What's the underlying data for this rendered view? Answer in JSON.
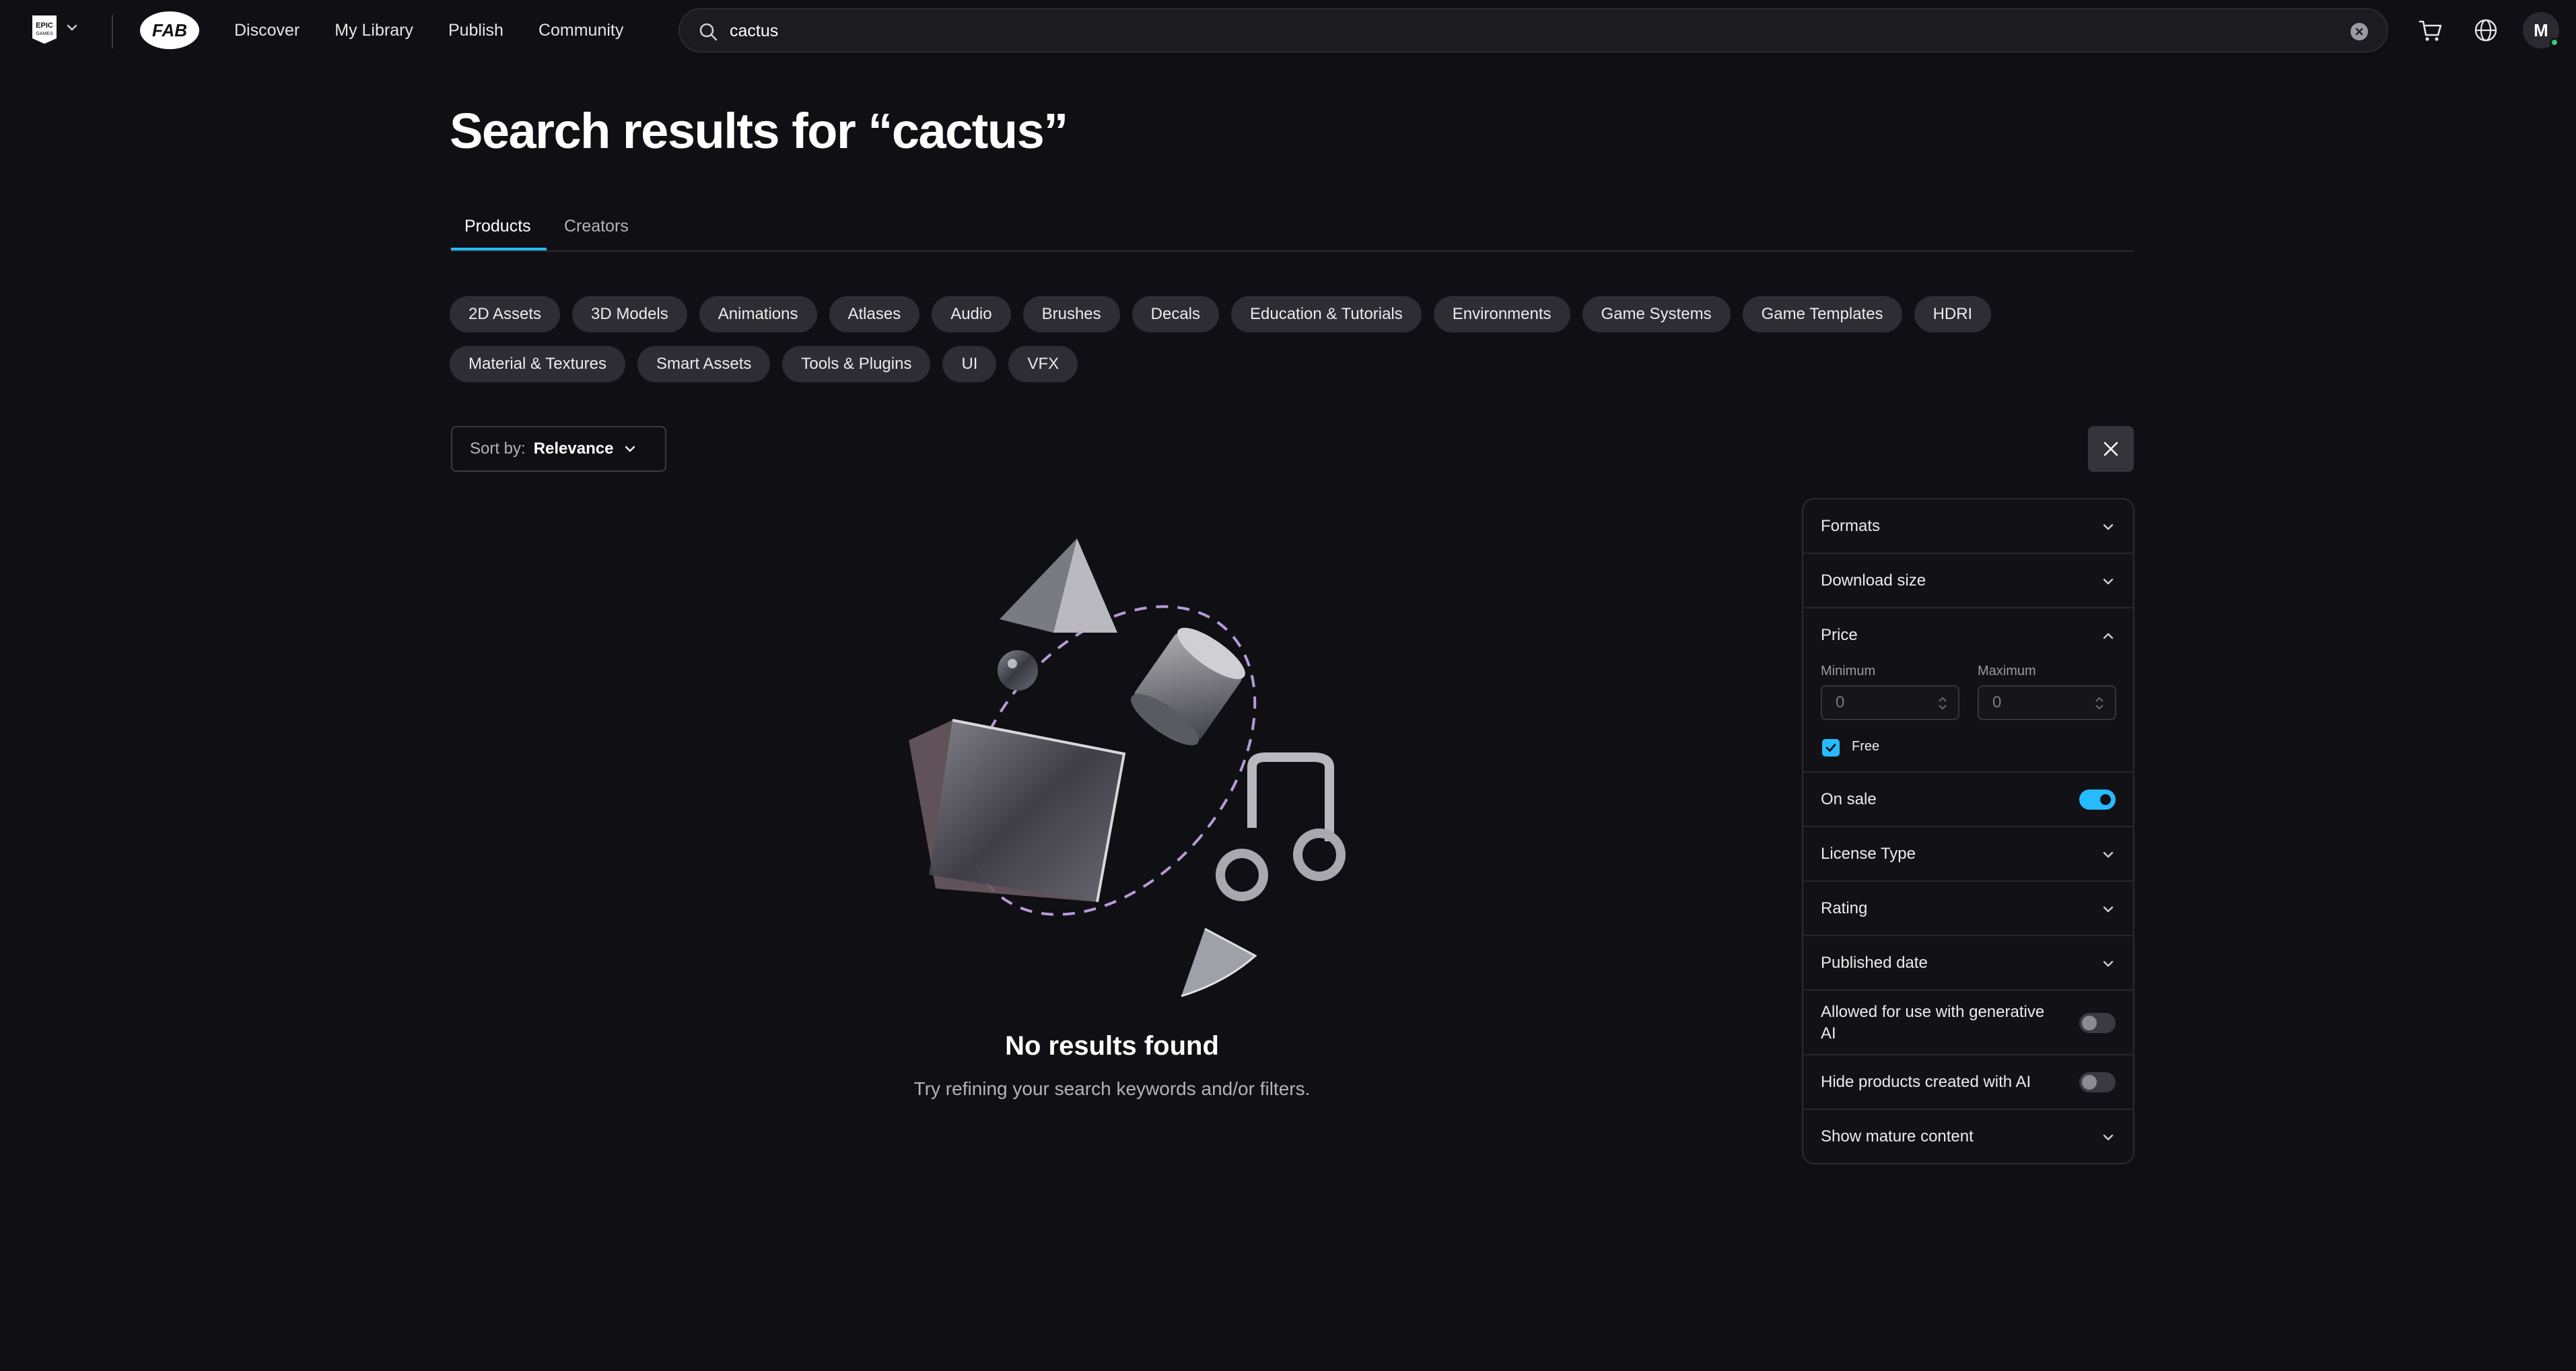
{
  "header": {
    "nav": [
      "Discover",
      "My Library",
      "Publish",
      "Community"
    ],
    "search": {
      "value": "cactus",
      "placeholder": ""
    },
    "avatar_initial": "M"
  },
  "page": {
    "title": "Search results for “cactus”",
    "tabs": [
      "Products",
      "Creators"
    ],
    "active_tab": "Products"
  },
  "categories": [
    "2D Assets",
    "3D Models",
    "Animations",
    "Atlases",
    "Audio",
    "Brushes",
    "Decals",
    "Education & Tutorials",
    "Environments",
    "Game Systems",
    "Game Templates",
    "HDRI",
    "Material & Textures",
    "Smart Assets",
    "Tools & Plugins",
    "UI",
    "VFX"
  ],
  "sort": {
    "label": "Sort by:",
    "value": "Relevance"
  },
  "empty_state": {
    "title": "No results found",
    "subtitle": "Try refining your search keywords and/or filters."
  },
  "filters": {
    "formats": "Formats",
    "download_size": "Download size",
    "price": {
      "label": "Price",
      "minimum_label": "Minimum",
      "maximum_label": "Maximum",
      "minimum_value": "0",
      "maximum_value": "0",
      "free_label": "Free",
      "free_checked": true
    },
    "on_sale": {
      "label": "On sale",
      "enabled": true
    },
    "license_type": "License Type",
    "rating": "Rating",
    "published_date": "Published date",
    "generative_ai": {
      "label": "Allowed for use with generative AI",
      "enabled": false
    },
    "hide_ai": {
      "label": "Hide products created with AI",
      "enabled": false
    },
    "mature": "Show mature content"
  },
  "colors": {
    "accent": "#26bbff",
    "background": "#101014",
    "chip": "#2d2d33"
  }
}
